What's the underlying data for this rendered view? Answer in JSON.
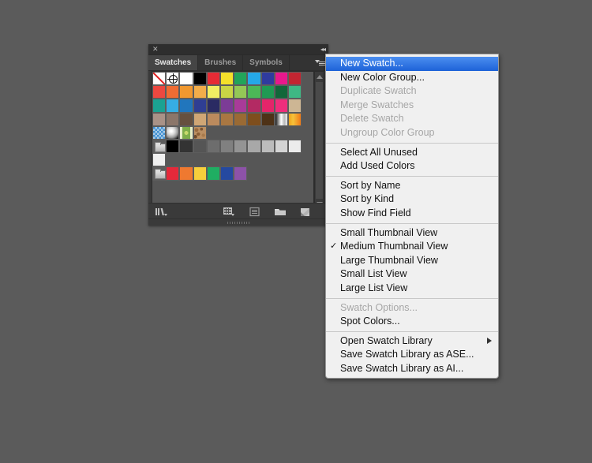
{
  "background_color": "#5b5b5b",
  "panel": {
    "close_icon": "✕",
    "collapse_icon": "◂◂",
    "tabs": [
      {
        "label": "Swatches",
        "active": true
      },
      {
        "label": "Brushes",
        "active": false
      },
      {
        "label": "Symbols",
        "active": false
      }
    ],
    "menu_button_name": "panel-options-menu-button",
    "footer_tools": [
      {
        "name": "swatch-libraries-menu-icon",
        "tooltip": "Swatch Libraries menu"
      },
      {
        "name": "show-swatch-kinds-menu-icon",
        "tooltip": "Show Swatch Kinds menu"
      },
      {
        "name": "swatch-options-icon",
        "tooltip": "Swatch Options"
      },
      {
        "name": "new-color-group-icon",
        "tooltip": "New Color Group"
      },
      {
        "name": "new-swatch-icon",
        "tooltip": "New Swatch"
      },
      {
        "name": "delete-swatch-icon",
        "tooltip": "Delete Swatch"
      }
    ],
    "scrollbar": {
      "up_arrow": "▲",
      "down_arrow": "▼"
    },
    "swatch_rows": [
      [
        {
          "type": "none"
        },
        {
          "type": "registration"
        },
        {
          "type": "color",
          "color": "#ffffff"
        },
        {
          "type": "color",
          "color": "#000000"
        },
        {
          "type": "color",
          "color": "#e52b35"
        },
        {
          "type": "color",
          "color": "#f5e02a"
        },
        {
          "type": "color",
          "color": "#22a45a"
        },
        {
          "type": "color",
          "color": "#25a8e8"
        },
        {
          "type": "color",
          "color": "#2f3b9e"
        },
        {
          "type": "color",
          "color": "#e8188c"
        },
        {
          "type": "color",
          "color": "#c32531"
        }
      ],
      [
        {
          "type": "color",
          "color": "#ec4840"
        },
        {
          "type": "color",
          "color": "#ef6c33"
        },
        {
          "type": "color",
          "color": "#f0982f"
        },
        {
          "type": "color",
          "color": "#f2ad4a"
        },
        {
          "type": "color",
          "color": "#f0ee63"
        },
        {
          "type": "color",
          "color": "#cad545"
        },
        {
          "type": "color",
          "color": "#94c756"
        },
        {
          "type": "color",
          "color": "#4cb857"
        },
        {
          "type": "color",
          "color": "#1f9a53"
        },
        {
          "type": "color",
          "color": "#11673a"
        },
        {
          "type": "color",
          "color": "#3fb884"
        }
      ],
      [
        {
          "type": "color",
          "color": "#1ba292"
        },
        {
          "type": "color",
          "color": "#36ade3"
        },
        {
          "type": "color",
          "color": "#2176bd"
        },
        {
          "type": "color",
          "color": "#2f3e93"
        },
        {
          "type": "color",
          "color": "#2a2b63"
        },
        {
          "type": "color",
          "color": "#7c3c96"
        },
        {
          "type": "color",
          "color": "#a93b99"
        },
        {
          "type": "color",
          "color": "#b32a63"
        },
        {
          "type": "color",
          "color": "#e4256a"
        },
        {
          "type": "color",
          "color": "#ef2e7c"
        },
        {
          "type": "color",
          "color": "#cdb694"
        }
      ],
      [
        {
          "type": "color",
          "color": "#a99287"
        },
        {
          "type": "color",
          "color": "#8b766a"
        },
        {
          "type": "color",
          "color": "#66503f"
        },
        {
          "type": "color",
          "color": "#d0a675"
        },
        {
          "type": "color",
          "color": "#bb8a5d"
        },
        {
          "type": "color",
          "color": "#a97742"
        },
        {
          "type": "color",
          "color": "#9a6a34"
        },
        {
          "type": "color",
          "color": "#7e4e1d"
        },
        {
          "type": "color",
          "color": "#4e3217"
        },
        {
          "type": "gradient-bw"
        },
        {
          "type": "gradient-orange"
        }
      ],
      [
        {
          "type": "pattern-blue"
        },
        {
          "type": "pattern-ball"
        },
        {
          "type": "pattern-green"
        },
        {
          "type": "pattern-brown"
        },
        {
          "type": "empty"
        },
        {
          "type": "empty"
        },
        {
          "type": "empty"
        },
        {
          "type": "empty"
        },
        {
          "type": "empty"
        },
        {
          "type": "empty"
        },
        {
          "type": "empty"
        }
      ],
      [
        {
          "type": "folder"
        },
        {
          "type": "color",
          "color": "#000000"
        },
        {
          "type": "color",
          "color": "#333333"
        },
        {
          "type": "color",
          "color": "#555555"
        },
        {
          "type": "color",
          "color": "#6d6d6d"
        },
        {
          "type": "color",
          "color": "#808080"
        },
        {
          "type": "color",
          "color": "#949494"
        },
        {
          "type": "color",
          "color": "#a8a8a8"
        },
        {
          "type": "color",
          "color": "#bcbcbc"
        },
        {
          "type": "color",
          "color": "#d4d4d4"
        },
        {
          "type": "color",
          "color": "#ececec"
        }
      ],
      [
        {
          "type": "color",
          "color": "#f0f0f0"
        },
        {
          "type": "empty"
        },
        {
          "type": "empty"
        },
        {
          "type": "empty"
        },
        {
          "type": "empty"
        },
        {
          "type": "empty"
        },
        {
          "type": "empty"
        },
        {
          "type": "empty"
        },
        {
          "type": "empty"
        },
        {
          "type": "empty"
        },
        {
          "type": "empty"
        }
      ],
      [
        {
          "type": "folder"
        },
        {
          "type": "color",
          "color": "#e5293a"
        },
        {
          "type": "color",
          "color": "#ef7930"
        },
        {
          "type": "color",
          "color": "#f7cf3c"
        },
        {
          "type": "color",
          "color": "#1fae62"
        },
        {
          "type": "color",
          "color": "#2549a0"
        },
        {
          "type": "color",
          "color": "#8d52a8"
        },
        {
          "type": "empty"
        },
        {
          "type": "empty"
        },
        {
          "type": "empty"
        },
        {
          "type": "empty"
        }
      ]
    ]
  },
  "context_menu": {
    "highlight_color": "#2f6fdf",
    "groups": [
      {
        "items": [
          {
            "label": "New Swatch...",
            "state": "highlighted"
          },
          {
            "label": "New Color Group...",
            "state": "enabled"
          },
          {
            "label": "Duplicate Swatch",
            "state": "disabled"
          },
          {
            "label": "Merge Swatches",
            "state": "disabled"
          },
          {
            "label": "Delete Swatch",
            "state": "disabled"
          },
          {
            "label": "Ungroup Color Group",
            "state": "disabled"
          }
        ]
      },
      {
        "items": [
          {
            "label": "Select All Unused",
            "state": "enabled"
          },
          {
            "label": "Add Used Colors",
            "state": "enabled"
          }
        ]
      },
      {
        "items": [
          {
            "label": "Sort by Name",
            "state": "enabled"
          },
          {
            "label": "Sort by Kind",
            "state": "enabled"
          },
          {
            "label": "Show Find Field",
            "state": "enabled"
          }
        ]
      },
      {
        "items": [
          {
            "label": "Small Thumbnail View",
            "state": "enabled"
          },
          {
            "label": "Medium Thumbnail View",
            "state": "enabled",
            "checked": true
          },
          {
            "label": "Large Thumbnail View",
            "state": "enabled"
          },
          {
            "label": "Small List View",
            "state": "enabled"
          },
          {
            "label": "Large List View",
            "state": "enabled"
          }
        ]
      },
      {
        "items": [
          {
            "label": "Swatch Options...",
            "state": "disabled"
          },
          {
            "label": "Spot Colors...",
            "state": "enabled"
          }
        ]
      },
      {
        "items": [
          {
            "label": "Open Swatch Library",
            "state": "enabled",
            "submenu": true
          },
          {
            "label": "Save Swatch Library as ASE...",
            "state": "enabled"
          },
          {
            "label": "Save Swatch Library as AI...",
            "state": "enabled"
          }
        ]
      }
    ],
    "check_glyph": "✓"
  }
}
